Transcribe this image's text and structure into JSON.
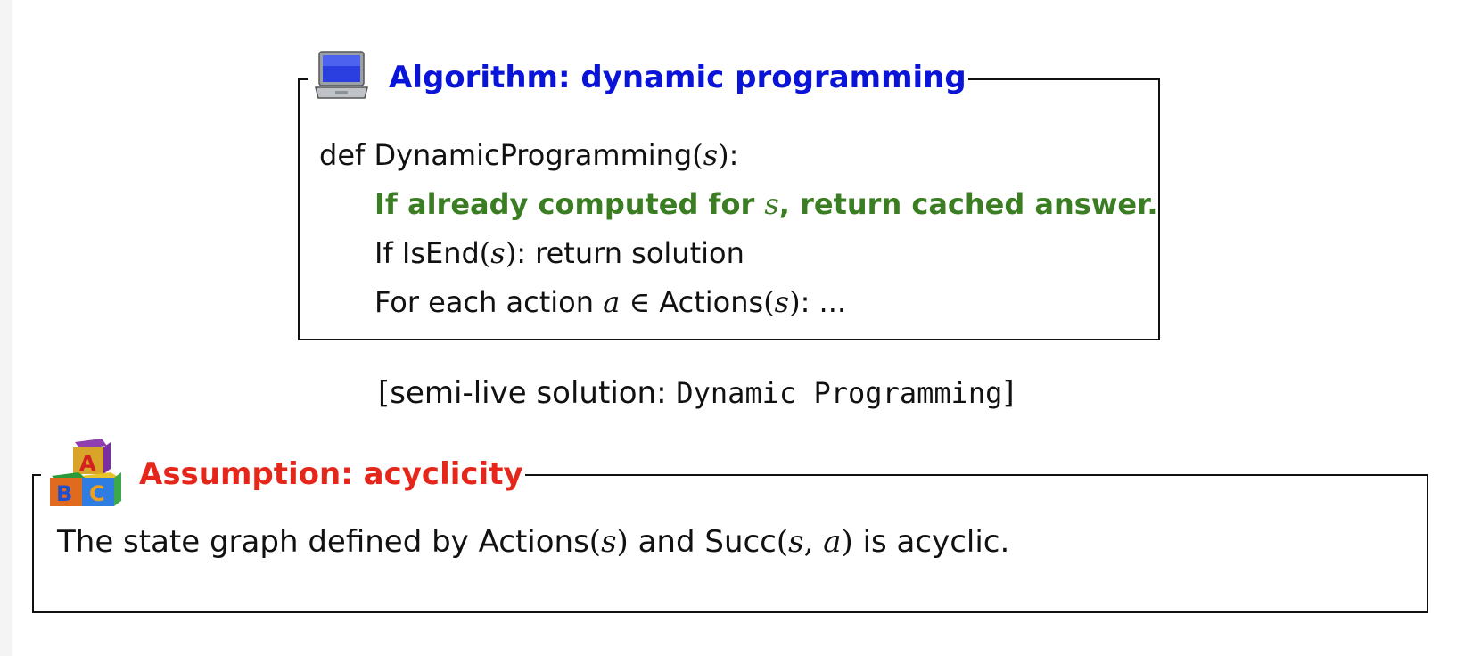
{
  "algorithm": {
    "title": "Algorithm: dynamic programming",
    "icon": "laptop-icon",
    "lines": {
      "def_prefix": "def DynamicProgramming",
      "def_arg": "s",
      "def_suffix": ":",
      "cache_prefix": "If already computed for ",
      "cache_var": "s",
      "cache_suffix": ", return cached answer.",
      "isend_prefix": "If IsEnd",
      "isend_arg": "s",
      "isend_suffix": ": return solution",
      "foreach_prefix": "For each action ",
      "foreach_var": "a",
      "foreach_in": " ∈ ",
      "foreach_fn": "Actions",
      "foreach_arg": "s",
      "foreach_suffix": ": ..."
    }
  },
  "semi_live": {
    "prefix": "[semi-live solution: ",
    "code": "Dynamic Programming",
    "suffix": "]"
  },
  "assumption": {
    "title": "Assumption: acyclicity",
    "icon": "abc-blocks-icon",
    "text_1": "The state graph defined by Actions",
    "arg_1": "s",
    "text_2": " and Succ",
    "arg_2a": "s",
    "comma": ", ",
    "arg_2b": "a",
    "text_3": " is acyclic."
  },
  "colors": {
    "algorithm_title": "#0a14d8",
    "cache_line": "#3a7d22",
    "assumption_title": "#e5261b"
  }
}
